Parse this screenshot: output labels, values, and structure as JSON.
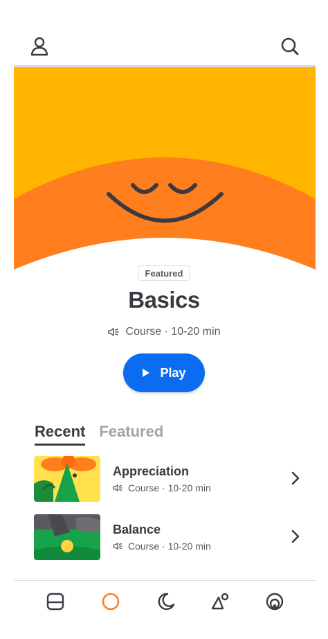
{
  "header": {
    "profile_icon": "person-icon",
    "search_icon": "search-icon"
  },
  "hero": {
    "colors": {
      "sky": "#FFB500",
      "hill": "#FF7E1D",
      "face": "#3B3A42"
    }
  },
  "featured": {
    "badge": "Featured",
    "title": "Basics",
    "meta": "Course · 10-20 min",
    "play_label": "Play",
    "accent": "#0B6CF2"
  },
  "tabs": [
    {
      "label": "Recent",
      "active": true
    },
    {
      "label": "Featured",
      "active": false
    }
  ],
  "list": [
    {
      "title": "Appreciation",
      "meta": "Course · 10-20 min"
    },
    {
      "title": "Balance",
      "meta": "Course · 10-20 min"
    }
  ],
  "nav": {
    "items": [
      "today-icon",
      "meditate-icon",
      "sleep-icon",
      "move-icon",
      "focus-icon"
    ],
    "active_color": "#FF7E1D"
  }
}
